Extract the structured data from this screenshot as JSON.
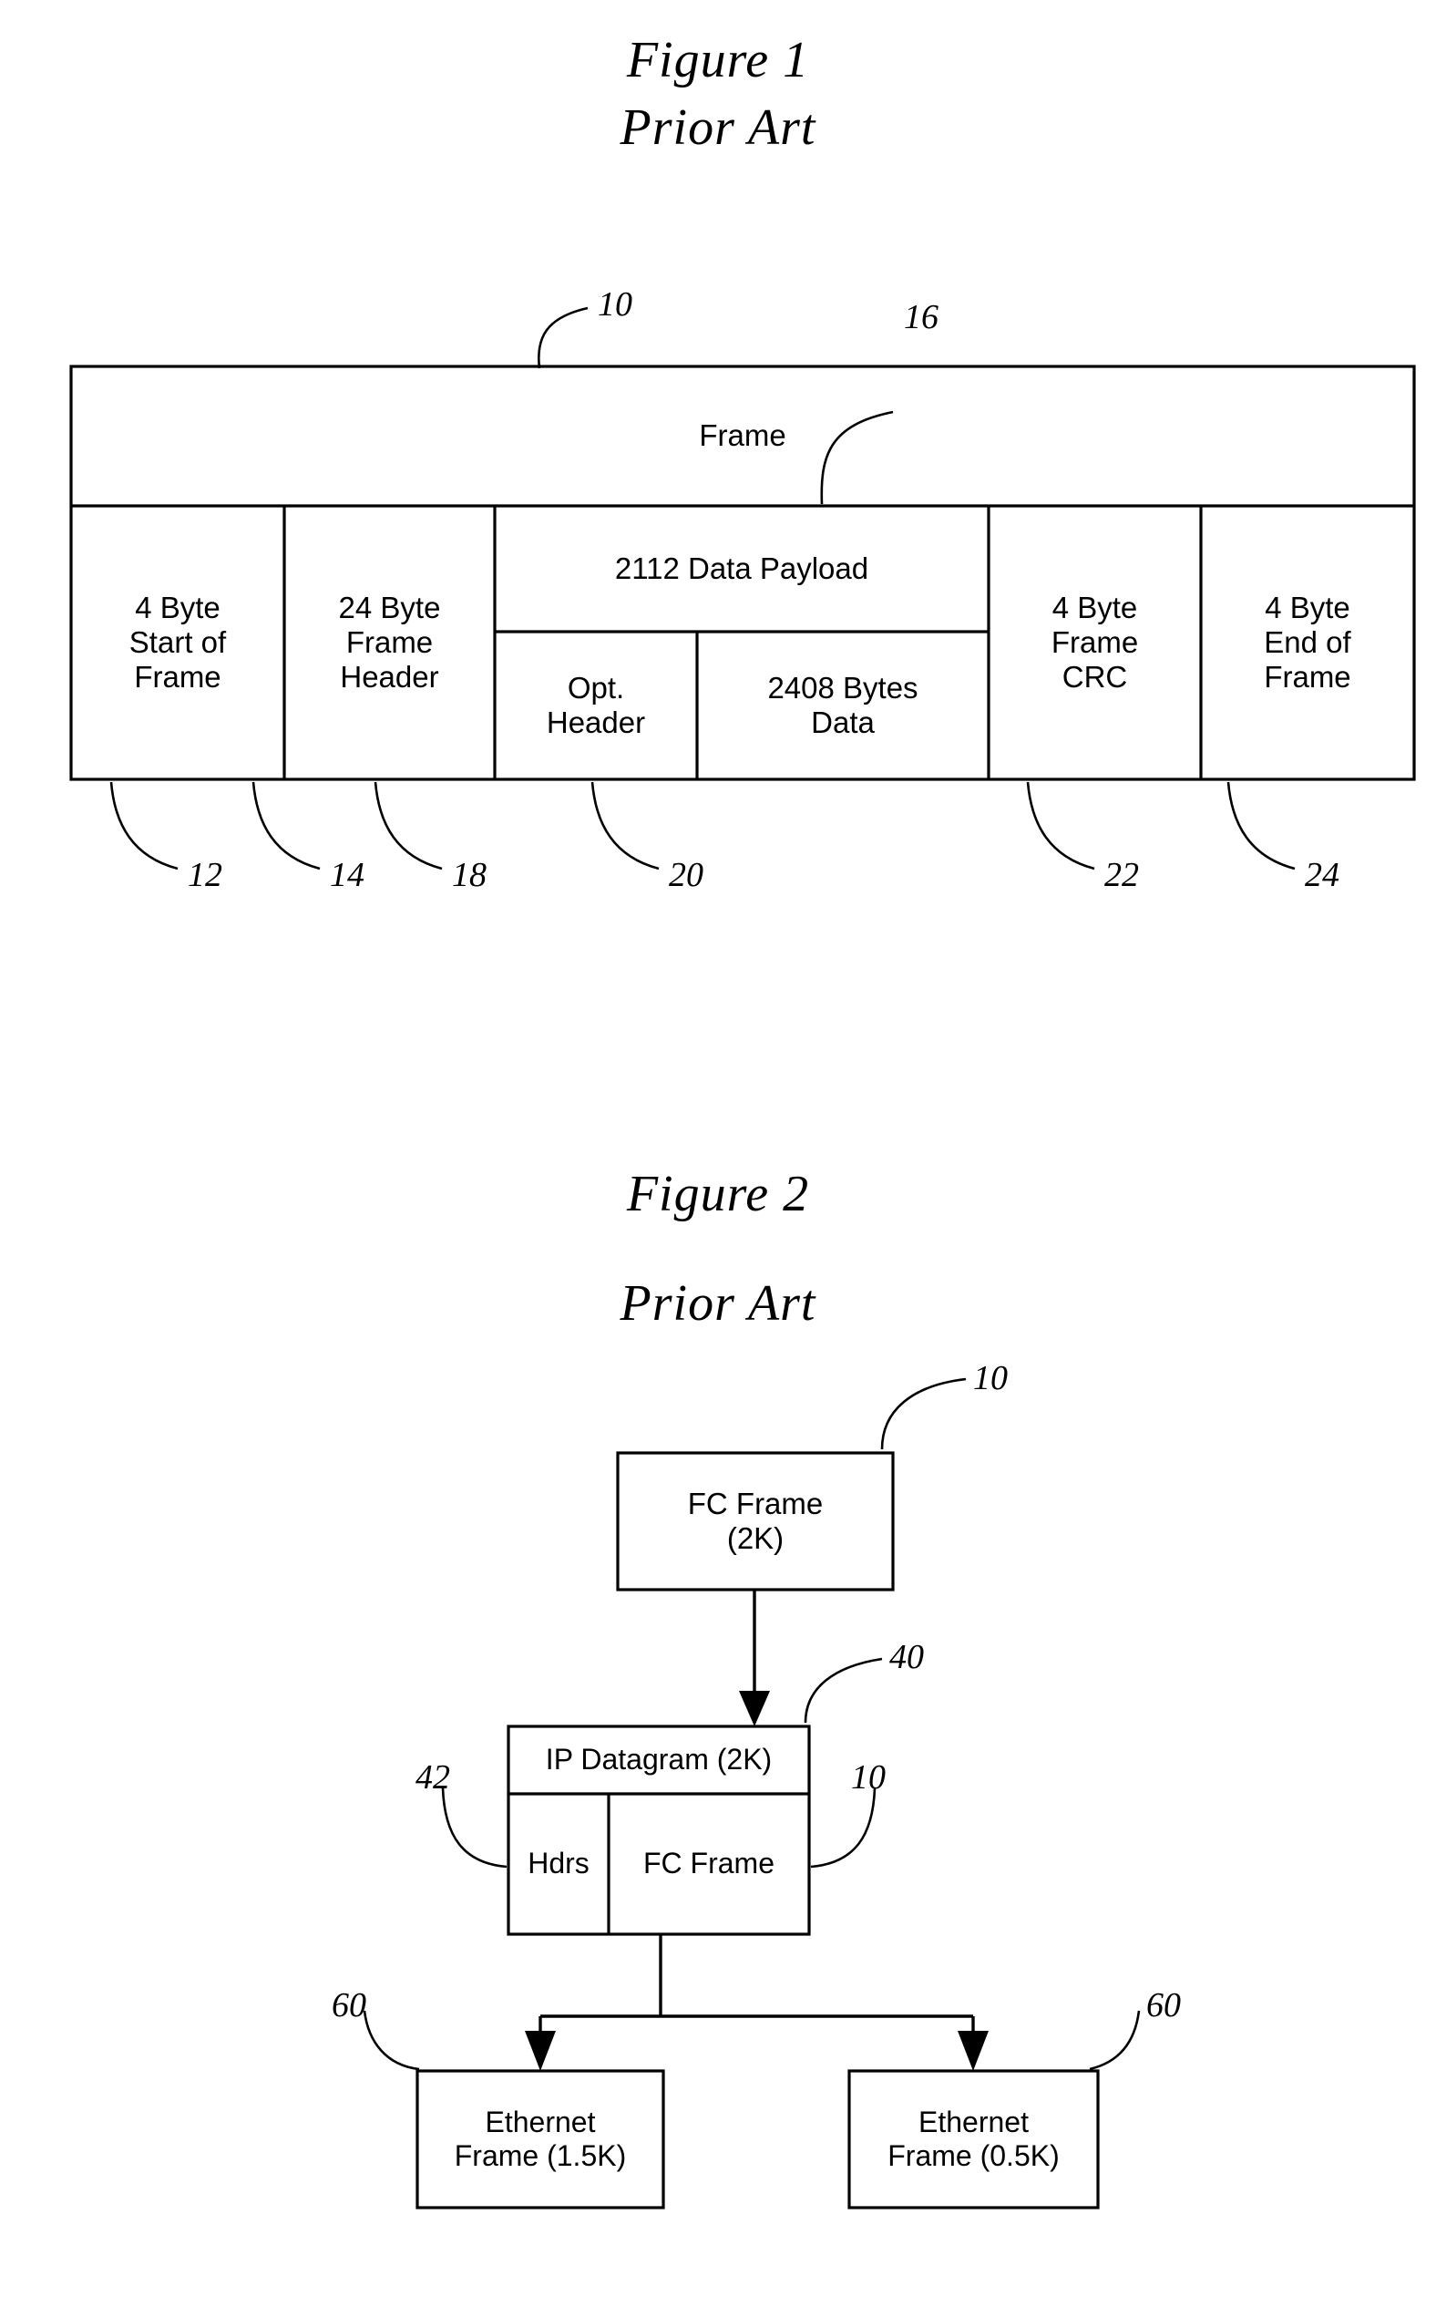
{
  "figure1": {
    "title": "Figure 1",
    "subtitle": "Prior Art",
    "frame_label": "Frame",
    "cells": [
      {
        "id": "sof",
        "label": "4 Byte\nStart of\nFrame"
      },
      {
        "id": "hdr",
        "label": "24 Byte\nFrame\nHeader"
      },
      {
        "id": "payload",
        "label": "2112 Data Payload"
      },
      {
        "id": "opthdr",
        "label": "Opt.\nHeader"
      },
      {
        "id": "data",
        "label": "2408 Bytes\nData"
      },
      {
        "id": "crc",
        "label": "4 Byte\nFrame\nCRC"
      },
      {
        "id": "eof",
        "label": "4 Byte\nEnd of\nFrame"
      }
    ],
    "refs": {
      "frame": "10",
      "payload": "16",
      "sof": "12",
      "hdr": "14",
      "opthdr": "18",
      "data": "20",
      "crc": "22",
      "eof": "24"
    }
  },
  "figure2": {
    "title": "Figure 2",
    "subtitle": "Prior Art",
    "nodes": [
      {
        "id": "fcframe",
        "label": "FC Frame\n(2K)"
      },
      {
        "id": "ipdatagram",
        "label": "IP Datagram (2K)"
      },
      {
        "id": "hdrs",
        "label": "Hdrs"
      },
      {
        "id": "fcframe2",
        "label": "FC Frame"
      },
      {
        "id": "eth15",
        "label": "Ethernet\nFrame (1.5K)"
      },
      {
        "id": "eth05",
        "label": "Ethernet\nFrame (0.5K)"
      }
    ],
    "refs": {
      "fcframe": "10",
      "ipdatagram": "40",
      "hdrs": "42",
      "fcframe2": "10",
      "eth_left": "60",
      "eth_right": "60"
    }
  },
  "colors": {
    "ink": "#000000",
    "paper": "#ffffff"
  }
}
